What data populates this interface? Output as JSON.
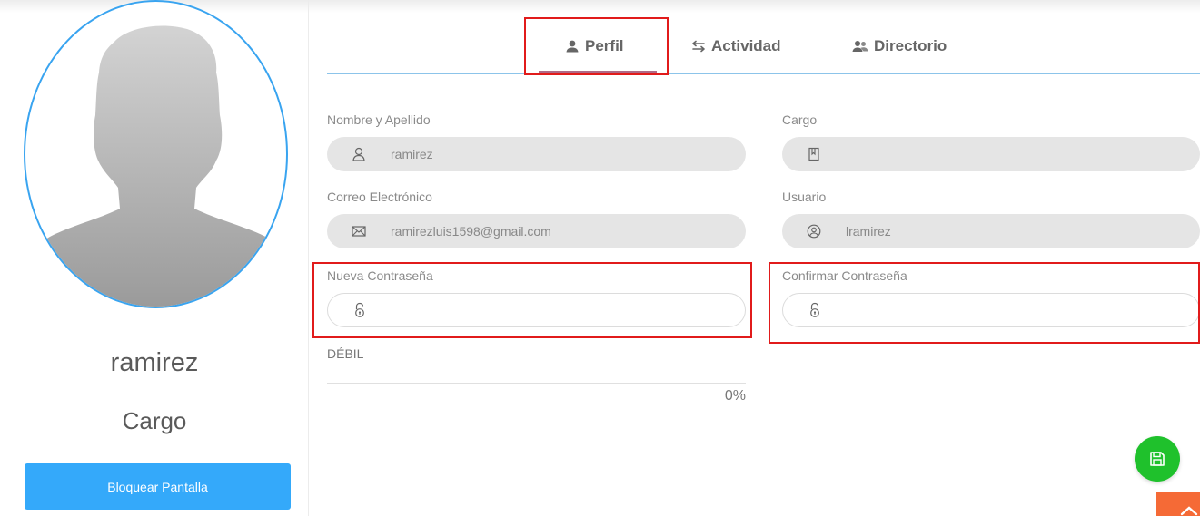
{
  "profile": {
    "name": "ramirez",
    "role": "Cargo",
    "lock_button": "Bloquear Pantalla",
    "avatar_icon": "default-user-silhouette"
  },
  "tabs": [
    {
      "label": "Perfil",
      "icon": "person-icon",
      "active": true
    },
    {
      "label": "Actividad",
      "icon": "swap-arrows-icon",
      "active": false
    },
    {
      "label": "Directorio",
      "icon": "people-icon",
      "active": false
    }
  ],
  "form": {
    "name": {
      "label": "Nombre y Apellido",
      "value": "ramirez",
      "icon": "user-outline-icon"
    },
    "cargo": {
      "label": "Cargo",
      "value": "",
      "icon": "book-icon"
    },
    "email": {
      "label": "Correo Electrónico",
      "value": "ramirezluis1598@gmail.com",
      "icon": "envelope-icon"
    },
    "usuario": {
      "label": "Usuario",
      "value": "lramirez",
      "icon": "user-circle-icon"
    },
    "new_password": {
      "label": "Nueva Contraseña",
      "value": "",
      "icon": "unlock-icon"
    },
    "confirm_password": {
      "label": "Confirmar Contraseña",
      "value": "",
      "icon": "unlock-icon"
    }
  },
  "strength": {
    "label": "DÉBIL",
    "percent_text": "0%",
    "percent": 0
  },
  "colors": {
    "accent_blue": "#34a9fa",
    "avatar_ring": "#39a4f0",
    "save_green": "#1fc12c",
    "scroll_orange": "#f56a36",
    "tab_underline": "#b06a86",
    "highlight_red": "#e11b1b"
  },
  "actions": {
    "save_icon": "floppy-disk-icon",
    "scroll_top_icon": "chevron-up-icon"
  }
}
